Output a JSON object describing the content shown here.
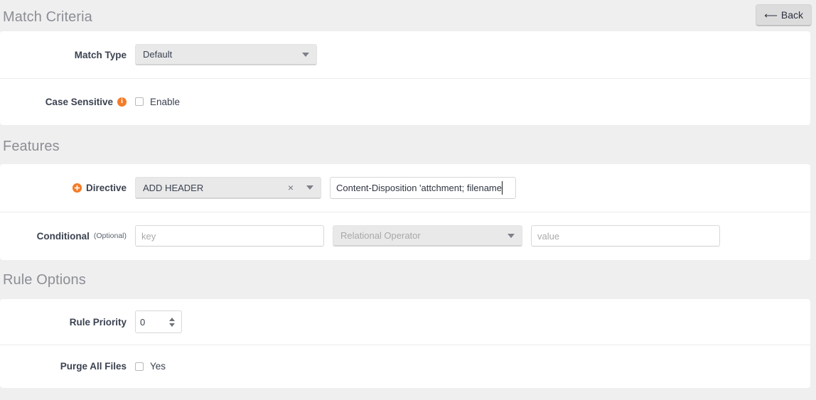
{
  "header": {
    "back_label": "Back",
    "back_icon": "arrow-left-icon"
  },
  "colors": {
    "accent_orange": "#f47b28",
    "page_background": "#efefef",
    "panel_background": "#ffffff",
    "section_title": "#8b8e95"
  },
  "sections": [
    {
      "id": "match-criteria",
      "title": "Match Criteria",
      "rows": [
        {
          "id": "match-type",
          "label": "Match Type",
          "control": "select",
          "value": "Default"
        },
        {
          "id": "case-sensitive",
          "label": "Case Sensitive",
          "info_icon": "info-icon",
          "control": "checkbox",
          "checkbox_label": "Enable",
          "checked": false
        }
      ]
    },
    {
      "id": "features",
      "title": "Features",
      "rows": [
        {
          "id": "directive",
          "label": "Directive",
          "add_icon": "plus-circle-icon",
          "select_value": "ADD HEADER",
          "clear_icon": "clear-x-icon",
          "caret_icon": "chevron-down-icon",
          "text_value": "Content-Disposition 'attchment; filename"
        },
        {
          "id": "conditional",
          "label": "Conditional",
          "label_suffix": "(Optional)",
          "key_placeholder": "key",
          "key_value": "",
          "operator_placeholder": "Relational Operator",
          "value_placeholder": "value",
          "value_value": ""
        }
      ]
    },
    {
      "id": "rule-options",
      "title": "Rule Options",
      "rows": [
        {
          "id": "rule-priority",
          "label": "Rule Priority",
          "control": "number",
          "value": "0"
        },
        {
          "id": "purge-all-files",
          "label": "Purge All Files",
          "control": "checkbox",
          "checkbox_label": "Yes",
          "checked": false
        }
      ]
    }
  ]
}
